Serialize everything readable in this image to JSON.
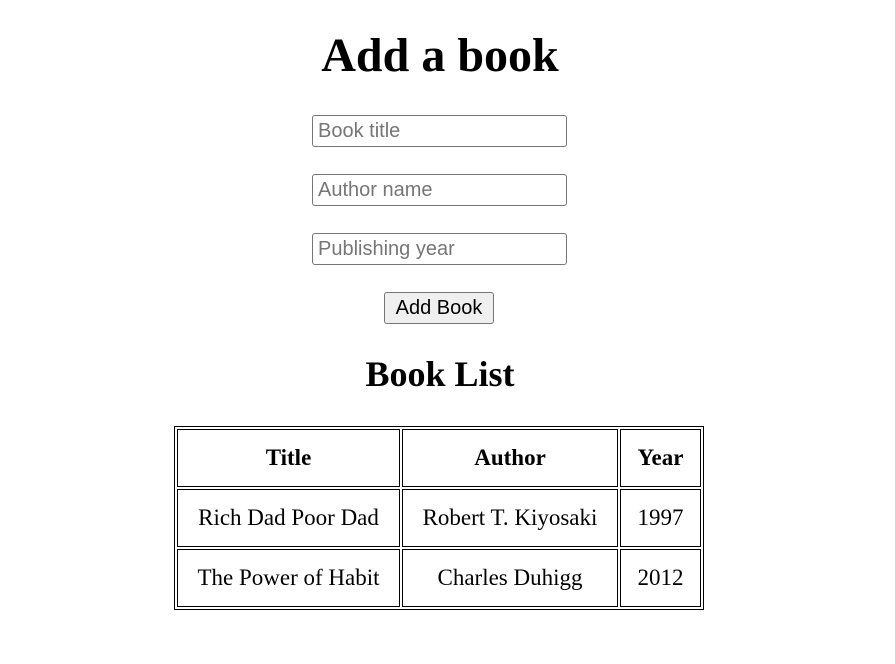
{
  "form": {
    "heading": "Add a book",
    "title_placeholder": "Book title",
    "author_placeholder": "Author name",
    "year_placeholder": "Publishing year",
    "submit_label": "Add Book"
  },
  "book_list": {
    "heading": "Book List",
    "columns": [
      "Title",
      "Author",
      "Year"
    ],
    "rows": [
      [
        "Rich Dad Poor Dad",
        "Robert T. Kiyosaki",
        "1997"
      ],
      [
        "The Power of Habit",
        "Charles Duhigg",
        "2012"
      ]
    ]
  }
}
